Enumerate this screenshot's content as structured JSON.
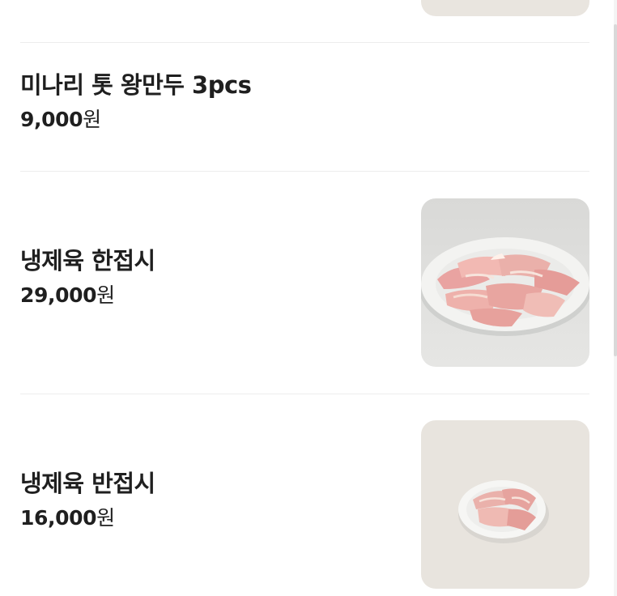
{
  "menu": {
    "items": [
      {
        "name": "미나리 톳 왕만두 3pcs",
        "price": "9,000",
        "currency": "원",
        "image": "none"
      },
      {
        "name": "냉제육 한접시",
        "price": "29,000",
        "currency": "원",
        "image": "sliced-pork-large-plate-photo"
      },
      {
        "name": "냉제육 반접시",
        "price": "16,000",
        "currency": "원",
        "image": "sliced-pork-small-plate-photo"
      }
    ]
  }
}
